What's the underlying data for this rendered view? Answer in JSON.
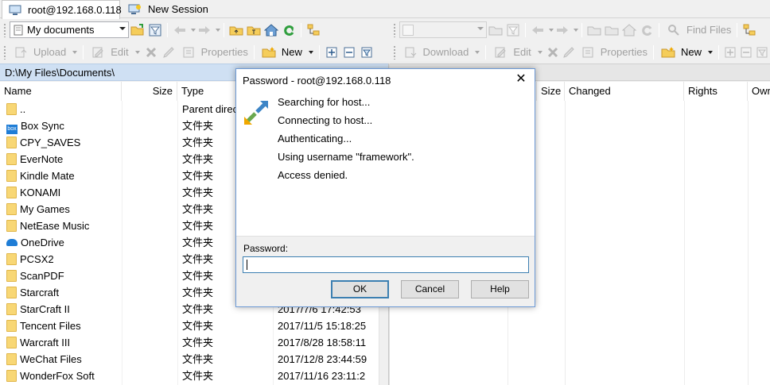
{
  "tabs": [
    {
      "label": "root@192.168.0.118",
      "active": true
    },
    {
      "label": "New Session",
      "active": false
    }
  ],
  "left_toolbar": {
    "location_combo": "My documents",
    "upload_label": "Upload",
    "edit_label": "Edit",
    "properties_label": "Properties",
    "new_label": "New"
  },
  "right_toolbar": {
    "location_combo": "",
    "find_files_label": "Find Files",
    "download_label": "Download",
    "edit_label": "Edit",
    "properties_label": "Properties",
    "new_label": "New"
  },
  "left_panel": {
    "path": "D:\\My Files\\Documents\\",
    "columns": {
      "name": "Name",
      "size": "Size",
      "type": "Type"
    },
    "rows": [
      {
        "name": "..",
        "type": "Parent direc",
        "changed": "",
        "icon": "parent-dir-icon"
      },
      {
        "name": "Box Sync",
        "type": "文件夹",
        "changed": "",
        "icon": "box-sync-icon"
      },
      {
        "name": "CPY_SAVES",
        "type": "文件夹",
        "changed": "",
        "icon": "folder-icon"
      },
      {
        "name": "EverNote",
        "type": "文件夹",
        "changed": "",
        "icon": "folder-icon"
      },
      {
        "name": "Kindle Mate",
        "type": "文件夹",
        "changed": "",
        "icon": "folder-icon"
      },
      {
        "name": "KONAMI",
        "type": "文件夹",
        "changed": "",
        "icon": "folder-icon"
      },
      {
        "name": "My Games",
        "type": "文件夹",
        "changed": "",
        "icon": "folder-icon"
      },
      {
        "name": "NetEase Music",
        "type": "文件夹",
        "changed": "",
        "icon": "folder-icon"
      },
      {
        "name": "OneDrive",
        "type": "文件夹",
        "changed": "",
        "icon": "onedrive-icon"
      },
      {
        "name": "PCSX2",
        "type": "文件夹",
        "changed": "",
        "icon": "folder-icon"
      },
      {
        "name": "ScanPDF",
        "type": "文件夹",
        "changed": "",
        "icon": "folder-icon"
      },
      {
        "name": "Starcraft",
        "type": "文件夹",
        "changed": "",
        "icon": "folder-icon"
      },
      {
        "name": "StarCraft II",
        "type": "文件夹",
        "changed": "2017/7/6  17:42:53",
        "icon": "folder-icon"
      },
      {
        "name": "Tencent Files",
        "type": "文件夹",
        "changed": "2017/11/5  15:18:25",
        "icon": "folder-icon"
      },
      {
        "name": "Warcraft III",
        "type": "文件夹",
        "changed": "2017/8/28  18:58:11",
        "icon": "folder-icon"
      },
      {
        "name": "WeChat Files",
        "type": "文件夹",
        "changed": "2017/12/8  23:44:59",
        "icon": "folder-icon"
      },
      {
        "name": "WonderFox Soft",
        "type": "文件夹",
        "changed": "2017/11/16  23:11:2",
        "icon": "folder-icon"
      }
    ]
  },
  "right_panel": {
    "columns": {
      "size": "Size",
      "changed": "Changed",
      "rights": "Rights",
      "owner": "Owr"
    }
  },
  "dialog": {
    "title": "Password - root@192.168.0.118",
    "messages": [
      "Searching for host...",
      "Connecting to host...",
      "Authenticating...",
      "Using username \"framework\".",
      "Access denied."
    ],
    "password_label": "Password:",
    "password_value": "",
    "ok_label": "OK",
    "cancel_label": "Cancel",
    "help_label": "Help"
  }
}
